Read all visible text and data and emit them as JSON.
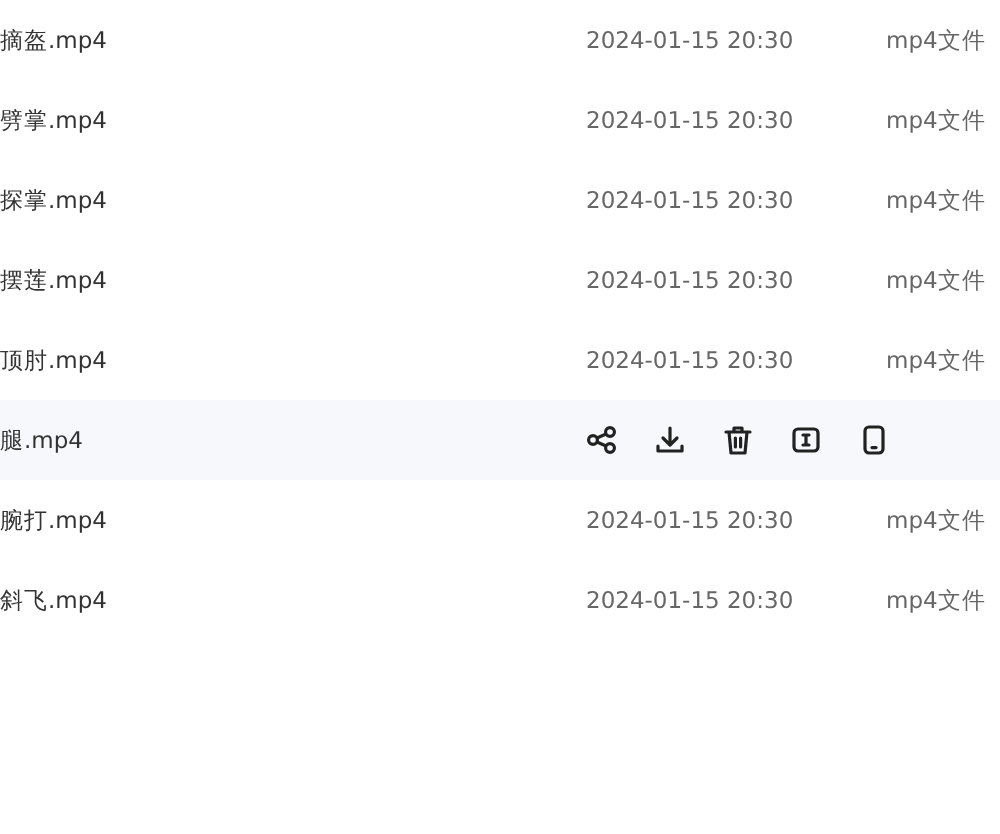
{
  "rows": [
    {
      "name": "摘盔.mp4",
      "modified": "2024-01-15 20:30",
      "type": "mp4文件",
      "hovered": false
    },
    {
      "name": "劈掌.mp4",
      "modified": "2024-01-15 20:30",
      "type": "mp4文件",
      "hovered": false
    },
    {
      "name": "探掌.mp4",
      "modified": "2024-01-15 20:30",
      "type": "mp4文件",
      "hovered": false
    },
    {
      "name": "摆莲.mp4",
      "modified": "2024-01-15 20:30",
      "type": "mp4文件",
      "hovered": false
    },
    {
      "name": "顶肘.mp4",
      "modified": "2024-01-15 20:30",
      "type": "mp4文件",
      "hovered": false
    },
    {
      "name": "腿.mp4",
      "hovered": true
    },
    {
      "name": "腕打.mp4",
      "modified": "2024-01-15 20:30",
      "type": "mp4文件",
      "hovered": false
    },
    {
      "name": "斜飞.mp4",
      "modified": "2024-01-15 20:30",
      "type": "mp4文件",
      "hovered": false
    }
  ]
}
